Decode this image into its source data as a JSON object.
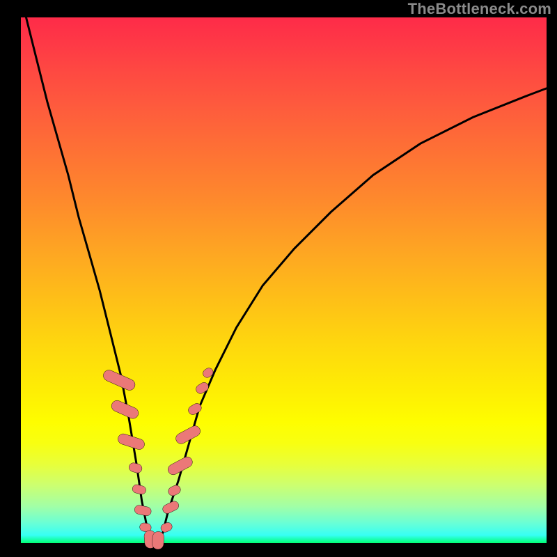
{
  "watermark": "TheBottleneck.com",
  "chart_data": {
    "type": "line",
    "title": "",
    "xlabel": "",
    "ylabel": "",
    "xlim": [
      0,
      100
    ],
    "ylim": [
      0,
      100
    ],
    "grid": false,
    "legend": false,
    "background_gradient": {
      "top_color": "#fe2b48",
      "bottom_color": "#00ff73",
      "description": "vertical rainbow gradient red→orange→yellow→green"
    },
    "series": [
      {
        "name": "curve",
        "x": [
          1,
          3,
          5,
          7,
          9,
          11,
          13,
          15,
          17,
          19,
          20.5,
          22,
          23,
          24,
          25,
          26,
          27,
          28,
          30,
          32,
          34,
          37,
          41,
          46,
          52,
          59,
          67,
          76,
          86,
          96,
          100
        ],
        "y": [
          100,
          92,
          84,
          77,
          70,
          62,
          55,
          48,
          40,
          32,
          24,
          15,
          8,
          3,
          0,
          0,
          2,
          6,
          12,
          19,
          26,
          33,
          41,
          49,
          56,
          63,
          70,
          76,
          81,
          85,
          86.5
        ]
      }
    ],
    "markers": [
      {
        "x": 18.7,
        "y": 31.0,
        "w": 2.1,
        "h": 6.4,
        "rot": -66
      },
      {
        "x": 19.8,
        "y": 25.4,
        "w": 2.1,
        "h": 5.4,
        "rot": -66
      },
      {
        "x": 21.0,
        "y": 19.3,
        "w": 2.0,
        "h": 5.2,
        "rot": -72
      },
      {
        "x": 21.8,
        "y": 14.3,
        "w": 1.7,
        "h": 2.5,
        "rot": -74
      },
      {
        "x": 22.5,
        "y": 10.2,
        "w": 1.6,
        "h": 2.6,
        "rot": -76
      },
      {
        "x": 23.2,
        "y": 6.2,
        "w": 1.7,
        "h": 3.2,
        "rot": -78
      },
      {
        "x": 23.7,
        "y": 3.0,
        "w": 1.6,
        "h": 2.2,
        "rot": -80
      },
      {
        "x": 24.6,
        "y": 0.7,
        "w": 2.2,
        "h": 3.4,
        "rot": -4
      },
      {
        "x": 26.1,
        "y": 0.5,
        "w": 2.2,
        "h": 3.4,
        "rot": 4
      },
      {
        "x": 27.7,
        "y": 3.0,
        "w": 1.6,
        "h": 2.2,
        "rot": 66
      },
      {
        "x": 28.5,
        "y": 6.8,
        "w": 1.7,
        "h": 3.2,
        "rot": 64
      },
      {
        "x": 29.2,
        "y": 10.0,
        "w": 1.7,
        "h": 2.4,
        "rot": 64
      },
      {
        "x": 30.3,
        "y": 14.7,
        "w": 2.0,
        "h": 5.0,
        "rot": 62
      },
      {
        "x": 31.8,
        "y": 20.6,
        "w": 2.0,
        "h": 5.0,
        "rot": 62
      },
      {
        "x": 33.1,
        "y": 25.5,
        "w": 1.7,
        "h": 2.6,
        "rot": 60
      },
      {
        "x": 34.5,
        "y": 29.5,
        "w": 1.7,
        "h": 2.5,
        "rot": 58
      },
      {
        "x": 35.6,
        "y": 32.4,
        "w": 1.6,
        "h": 2.0,
        "rot": 56
      }
    ]
  }
}
